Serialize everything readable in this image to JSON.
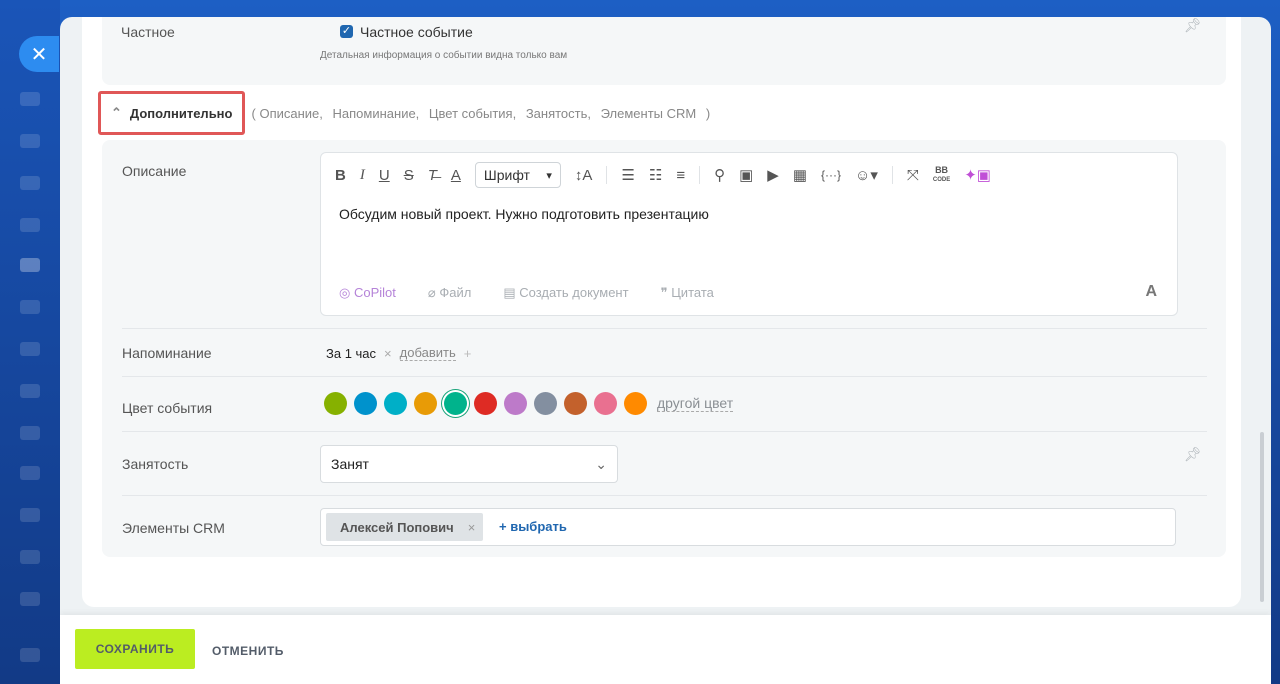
{
  "private": {
    "label": "Частное",
    "checkbox_label": "Частное событие",
    "hint": "Детальная информация о событии видна только вам"
  },
  "more": {
    "toggle_label": "Дополнительно",
    "items_open": "(",
    "items": [
      "Описание,",
      "Напоминание,",
      "Цвет события,",
      "Занятость,",
      "Элементы CRM"
    ],
    "items_close": ")"
  },
  "description": {
    "label": "Описание",
    "font_select": "Шрифт",
    "text": "Обсудим новый проект. Нужно подготовить презентацию",
    "footer": {
      "copilot": "CoPilot",
      "file": "Файл",
      "create_doc": "Создать документ",
      "quote": "Цитата"
    },
    "format_button": "A",
    "toolbar_icons": [
      "bold-icon",
      "italic-icon",
      "underline-icon",
      "strikethrough-icon",
      "clear-format-icon",
      "text-color-icon",
      "font-size-icon",
      "numbered-list-icon",
      "bullet-list-icon",
      "align-icon",
      "link-icon",
      "image-icon",
      "video-icon",
      "table-icon",
      "code-icon",
      "emoji-icon",
      "fullscreen-icon",
      "bbcode-icon",
      "ai-image-icon"
    ]
  },
  "reminder": {
    "label": "Напоминание",
    "value": "За 1 час",
    "add": "добавить"
  },
  "color": {
    "label": "Цвет события",
    "swatches": [
      "#86b100",
      "#0092cc",
      "#00afc7",
      "#e89b06",
      "#00b38c",
      "#de2b24",
      "#bd7ac9",
      "#838fa0",
      "#c3612c",
      "#e97090",
      "#ff8a00"
    ],
    "selected_index": 4,
    "other": "другой цвет"
  },
  "busy": {
    "label": "Занятость",
    "value": "Занят"
  },
  "crm": {
    "label": "Элементы CRM",
    "tag": "Алексей Попович",
    "pick": "+ выбрать"
  },
  "footer": {
    "save": "СОХРАНИТЬ",
    "cancel": "ОТМЕНИТЬ"
  }
}
